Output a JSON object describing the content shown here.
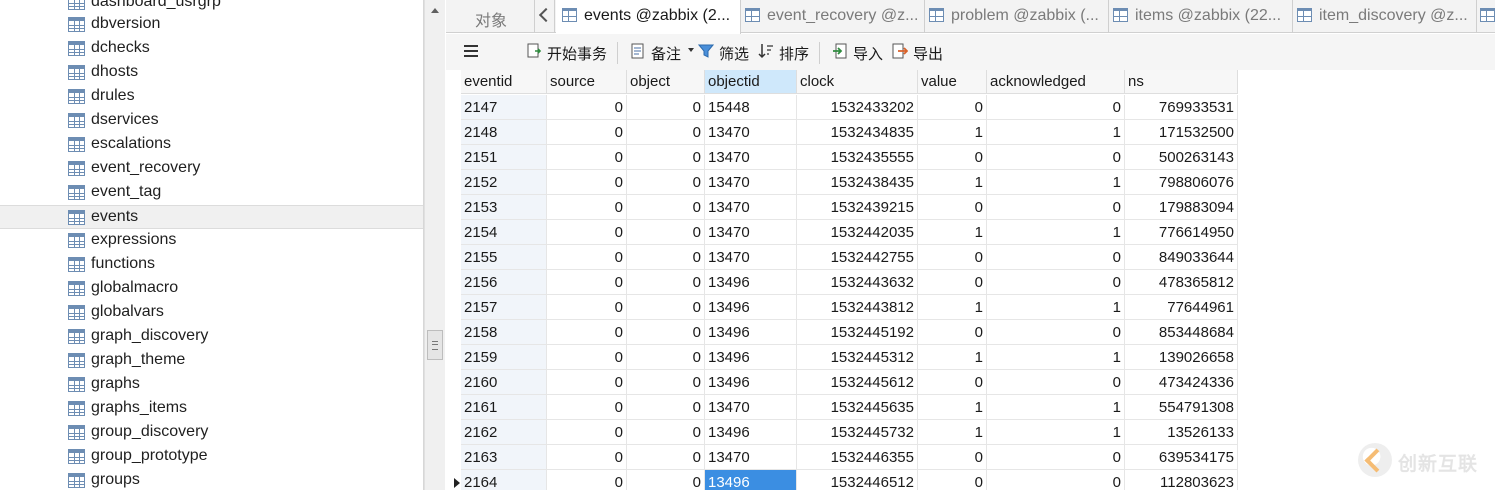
{
  "sidebar": {
    "items": [
      {
        "label": "dashboard_usrgrp"
      },
      {
        "label": "dbversion"
      },
      {
        "label": "dchecks"
      },
      {
        "label": "dhosts"
      },
      {
        "label": "drules"
      },
      {
        "label": "dservices"
      },
      {
        "label": "escalations"
      },
      {
        "label": "event_recovery"
      },
      {
        "label": "event_tag"
      },
      {
        "label": "events",
        "selected": true
      },
      {
        "label": "expressions"
      },
      {
        "label": "functions"
      },
      {
        "label": "globalmacro"
      },
      {
        "label": "globalvars"
      },
      {
        "label": "graph_discovery"
      },
      {
        "label": "graph_theme"
      },
      {
        "label": "graphs"
      },
      {
        "label": "graphs_items"
      },
      {
        "label": "group_discovery"
      },
      {
        "label": "group_prototype"
      },
      {
        "label": "groups"
      }
    ]
  },
  "tabs": {
    "objects": "对象",
    "items": [
      {
        "label": "events @zabbix (2...",
        "active": true
      },
      {
        "label": "event_recovery @z..."
      },
      {
        "label": "problem @zabbix (..."
      },
      {
        "label": "items @zabbix (22..."
      },
      {
        "label": "item_discovery @z..."
      }
    ]
  },
  "toolbar": {
    "begin_transaction": "开始事务",
    "memo": "备注",
    "filter": "筛选",
    "sort": "排序",
    "import": "导入",
    "export": "导出"
  },
  "grid": {
    "columns": [
      "eventid",
      "source",
      "object",
      "objectid",
      "clock",
      "value",
      "acknowledged",
      "ns"
    ],
    "selected_column": "objectid",
    "rows": [
      [
        "2147",
        "0",
        "0",
        "15448",
        "1532433202",
        "0",
        "0",
        "769933531"
      ],
      [
        "2148",
        "0",
        "0",
        "13470",
        "1532434835",
        "1",
        "1",
        "171532500"
      ],
      [
        "2151",
        "0",
        "0",
        "13470",
        "1532435555",
        "0",
        "0",
        "500263143"
      ],
      [
        "2152",
        "0",
        "0",
        "13470",
        "1532438435",
        "1",
        "1",
        "798806076"
      ],
      [
        "2153",
        "0",
        "0",
        "13470",
        "1532439215",
        "0",
        "0",
        "179883094"
      ],
      [
        "2154",
        "0",
        "0",
        "13470",
        "1532442035",
        "1",
        "1",
        "776614950"
      ],
      [
        "2155",
        "0",
        "0",
        "13470",
        "1532442755",
        "0",
        "0",
        "849033644"
      ],
      [
        "2156",
        "0",
        "0",
        "13496",
        "1532443632",
        "0",
        "0",
        "478365812"
      ],
      [
        "2157",
        "0",
        "0",
        "13496",
        "1532443812",
        "1",
        "1",
        "77644961"
      ],
      [
        "2158",
        "0",
        "0",
        "13496",
        "1532445192",
        "0",
        "0",
        "853448684"
      ],
      [
        "2159",
        "0",
        "0",
        "13496",
        "1532445312",
        "1",
        "1",
        "139026658"
      ],
      [
        "2160",
        "0",
        "0",
        "13496",
        "1532445612",
        "0",
        "0",
        "473424336"
      ],
      [
        "2161",
        "0",
        "0",
        "13470",
        "1532445635",
        "1",
        "1",
        "554791308"
      ],
      [
        "2162",
        "0",
        "0",
        "13496",
        "1532445732",
        "1",
        "1",
        "13526133"
      ],
      [
        "2163",
        "0",
        "0",
        "13470",
        "1532446355",
        "0",
        "0",
        "639534175"
      ],
      [
        "2164",
        "0",
        "0",
        "13496",
        "1532446512",
        "0",
        "0",
        "112803623"
      ]
    ],
    "current_row": "2164"
  },
  "watermark": {
    "text": "创新互联"
  },
  "colors": {
    "selection": "#3b8ee2",
    "header_selected": "#cfe8fb",
    "pk_column": "#f1f5fa"
  }
}
